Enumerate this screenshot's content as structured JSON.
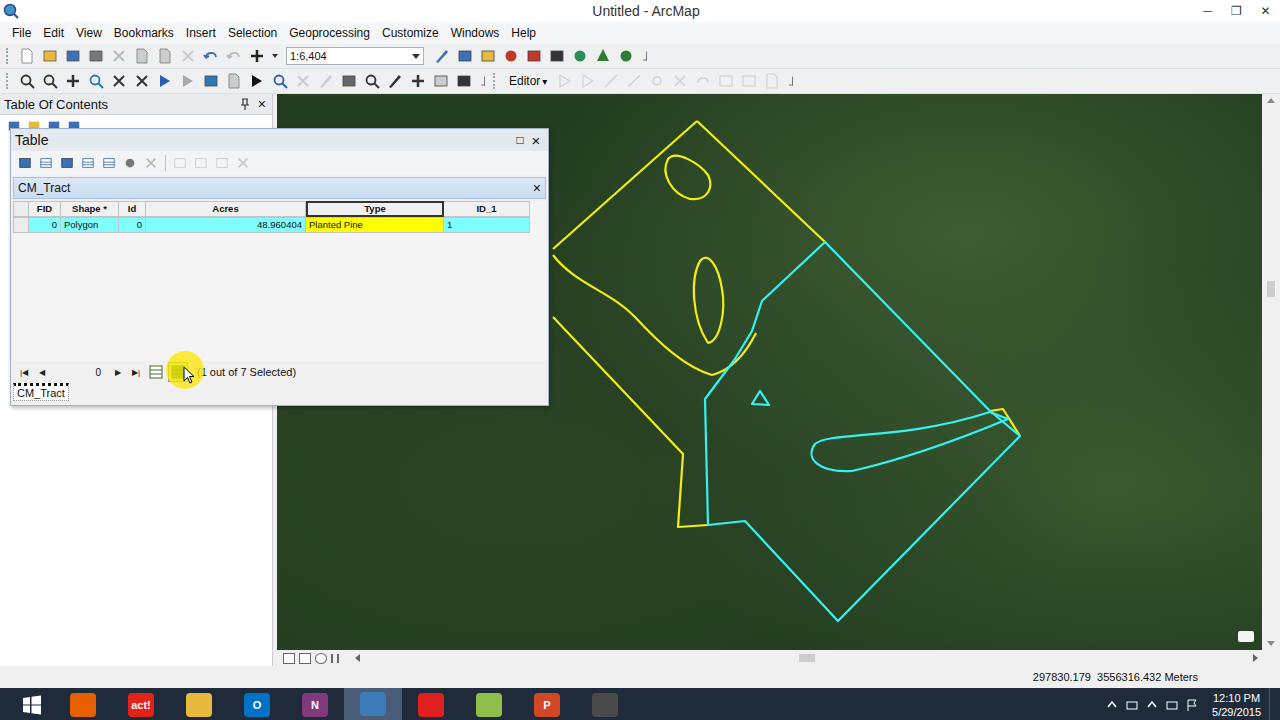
{
  "window": {
    "title": "Untitled - ArcMap",
    "controls": [
      "─",
      "❐",
      "✕"
    ]
  },
  "menu": [
    "File",
    "Edit",
    "View",
    "Bookmarks",
    "Insert",
    "Selection",
    "Geoprocessing",
    "Customize",
    "Windows",
    "Help"
  ],
  "toolbar": {
    "scale": "1:6,404",
    "editor": "Editor",
    "editor_arrow": "▾"
  },
  "toc": {
    "title": "Table Of Contents",
    "close": "×"
  },
  "table_window": {
    "title": "Table",
    "maximize": "□",
    "close": "×",
    "tab": {
      "label": "CM_Tract",
      "close": "×"
    },
    "columns": [
      {
        "label": "FID",
        "kind": "number",
        "selected": false
      },
      {
        "label": "Shape *",
        "kind": "text",
        "selected": false
      },
      {
        "label": "Id",
        "kind": "number",
        "selected": false
      },
      {
        "label": "Acres",
        "kind": "number",
        "selected": false
      },
      {
        "label": "Type",
        "kind": "text",
        "selected": true
      },
      {
        "label": "ID_1",
        "kind": "text",
        "selected": false
      }
    ],
    "rows": [
      {
        "selected": true,
        "cells": [
          "0",
          "Polygon",
          "0",
          "48.960404",
          "Planted Pine",
          "1"
        ]
      }
    ],
    "nav": {
      "prev": [
        "|◀",
        "◀"
      ],
      "record": "0",
      "next": [
        "▶",
        "▶|"
      ],
      "toggles": [
        {
          "selected": false
        },
        {
          "selected": true
        }
      ],
      "selection": "(1 out of 7 Selected)"
    },
    "bottom_tab": {
      "label": "CM_Tract",
      "selected": true
    }
  },
  "map": {
    "features": [
      {
        "selected": false
      },
      {
        "selected": true
      }
    ]
  },
  "status_bar": {
    "coordinates": "297830.179  3556316.432 Meters"
  },
  "taskbar": {
    "apps": [
      {
        "glyph": "",
        "color": "#e66000",
        "active": false
      },
      {
        "glyph": "act!",
        "color": "#e2231a",
        "active": false
      },
      {
        "glyph": "",
        "color": "#e8b93c",
        "active": false
      },
      {
        "glyph": "O",
        "color": "#0072c6",
        "active": false
      },
      {
        "glyph": "N",
        "color": "#80397b",
        "active": false
      },
      {
        "glyph": "",
        "color": "#3d7ab8",
        "active": true
      },
      {
        "glyph": "",
        "color": "#e02020",
        "active": false
      },
      {
        "glyph": "",
        "color": "#8dbf4a",
        "active": false
      },
      {
        "glyph": "P",
        "color": "#d24726",
        "active": false
      },
      {
        "glyph": "",
        "color": "#4a4a4a",
        "active": false
      }
    ],
    "time": "12:10 PM",
    "date": "5/29/2015"
  }
}
